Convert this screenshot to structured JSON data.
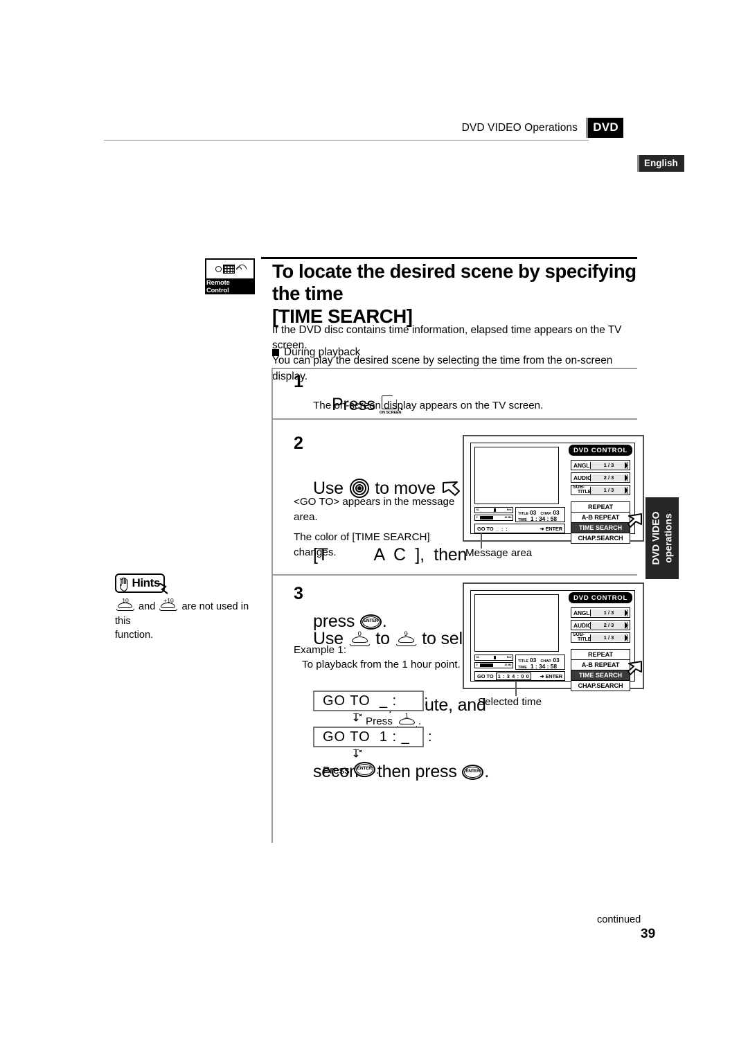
{
  "header": {
    "title": "DVD VIDEO Operations",
    "badge": "DVD",
    "language_badge": "English"
  },
  "title_block": {
    "remote_badge_label": "Remote Control",
    "heading_line1": "To locate the desired scene by specifying the time",
    "heading_line2": "[TIME SEARCH]",
    "intro_line1": "If the DVD disc contains time information, elapsed time appears on the TV screen.",
    "intro_line2": "You can play the desired scene by selecting the time from the on-screen display.",
    "subsection": "During playback"
  },
  "steps": [
    {
      "number": "1",
      "head_pre": "Press ",
      "head_post": ".",
      "key_caption": "ON SCREEN",
      "body": "The on-screen display appears on the TV screen."
    },
    {
      "number": "2",
      "head_1a": "Use ",
      "head_1b": " to move ",
      "head_1c": " to",
      "head_2": "[T          A  C  ],  then",
      "head_3a": "press ",
      "head_3b": ".",
      "enter_caption": "ENTER",
      "body1": "<GO TO> appears in the message",
      "body2": "area.",
      "body3": "The color of [TIME SEARCH]",
      "body4": "changes."
    },
    {
      "number": "3",
      "head_1a": "Use ",
      "head_1b": " to ",
      "head_1c": " to select the",
      "head_2": "time  hour, minute, and",
      "head_3a": "second  then press ",
      "head_3b": ".",
      "key_from": "0",
      "key_to": "9",
      "enter_caption": "ENTER",
      "example_label": "Example 1:",
      "example_text": "To playback from the 1 hour point."
    }
  ],
  "hints": {
    "title": "Hints",
    "key_1": "10",
    "key_2": "+10",
    "text_a": " and ",
    "text_b": " are not used in this",
    "text_c": "function."
  },
  "example_boxes": {
    "box1": "GO TO  _ :      :",
    "press1_label": "Press",
    "press1_key": "1",
    "press1_suffix": ".",
    "box2": "GO TO  1 : _    :",
    "press2_label": "Press",
    "press2_key_caption": "ENTER",
    "press2_suffix": "."
  },
  "osd_panels": [
    {
      "id": "panel-top",
      "title": "DVD CONTROL",
      "rows": [
        {
          "label": "ANGLE",
          "value": "1 / 3"
        },
        {
          "label": "AUDIO",
          "value": "2 / 3"
        },
        {
          "label_top": "SUB-",
          "label_bottom": "TITLE",
          "value": "1 / 3"
        }
      ],
      "buttons": [
        {
          "label": "REPEAT",
          "selected": false
        },
        {
          "label": "A-B REPEAT",
          "selected": false
        },
        {
          "label": "TIME SEARCH",
          "selected": true
        },
        {
          "label": "CHAP.SEARCH",
          "selected": false
        }
      ],
      "bar_top_left": "SL",
      "bar_top_right": "End",
      "bar_bottom_left": "0",
      "bar_bottom_right": "10 Mb",
      "info": {
        "title_key": "TITLE",
        "title_value": "03",
        "chap_key": "CHAP.",
        "chap_value": "03",
        "time_key": "TIME",
        "time_value": "1 : 34 : 58"
      },
      "goto": {
        "label": "GO TO",
        "value": "_ :      :",
        "enter": "ENTER"
      },
      "callout": "Message area"
    },
    {
      "id": "panel-bottom",
      "title": "DVD CONTROL",
      "rows": [
        {
          "label": "ANGLE",
          "value": "1 / 3"
        },
        {
          "label": "AUDIO",
          "value": "2 / 3"
        },
        {
          "label_top": "SUB-",
          "label_bottom": "TITLE",
          "value": "1 / 3"
        }
      ],
      "buttons": [
        {
          "label": "REPEAT",
          "selected": false
        },
        {
          "label": "A-B REPEAT",
          "selected": false
        },
        {
          "label": "TIME SEARCH",
          "selected": true
        },
        {
          "label": "CHAP.SEARCH",
          "selected": false
        }
      ],
      "bar_top_left": "SL",
      "bar_top_right": "End",
      "bar_bottom_left": "0",
      "bar_bottom_right": "10 Mb",
      "info": {
        "title_key": "TITLE",
        "title_value": "03",
        "chap_key": "CHAP.",
        "chap_value": "03",
        "time_key": "TIME",
        "time_value": "1 : 34 : 58"
      },
      "goto": {
        "label": "GO TO",
        "value": "1 : 3 4 : 0 0",
        "enter": "ENTER"
      },
      "callout": "Selected time"
    }
  ],
  "side_tab": {
    "line1": "DVD VIDEO",
    "line2": "operations"
  },
  "footer": {
    "continued": "continued",
    "page_number": "39"
  }
}
